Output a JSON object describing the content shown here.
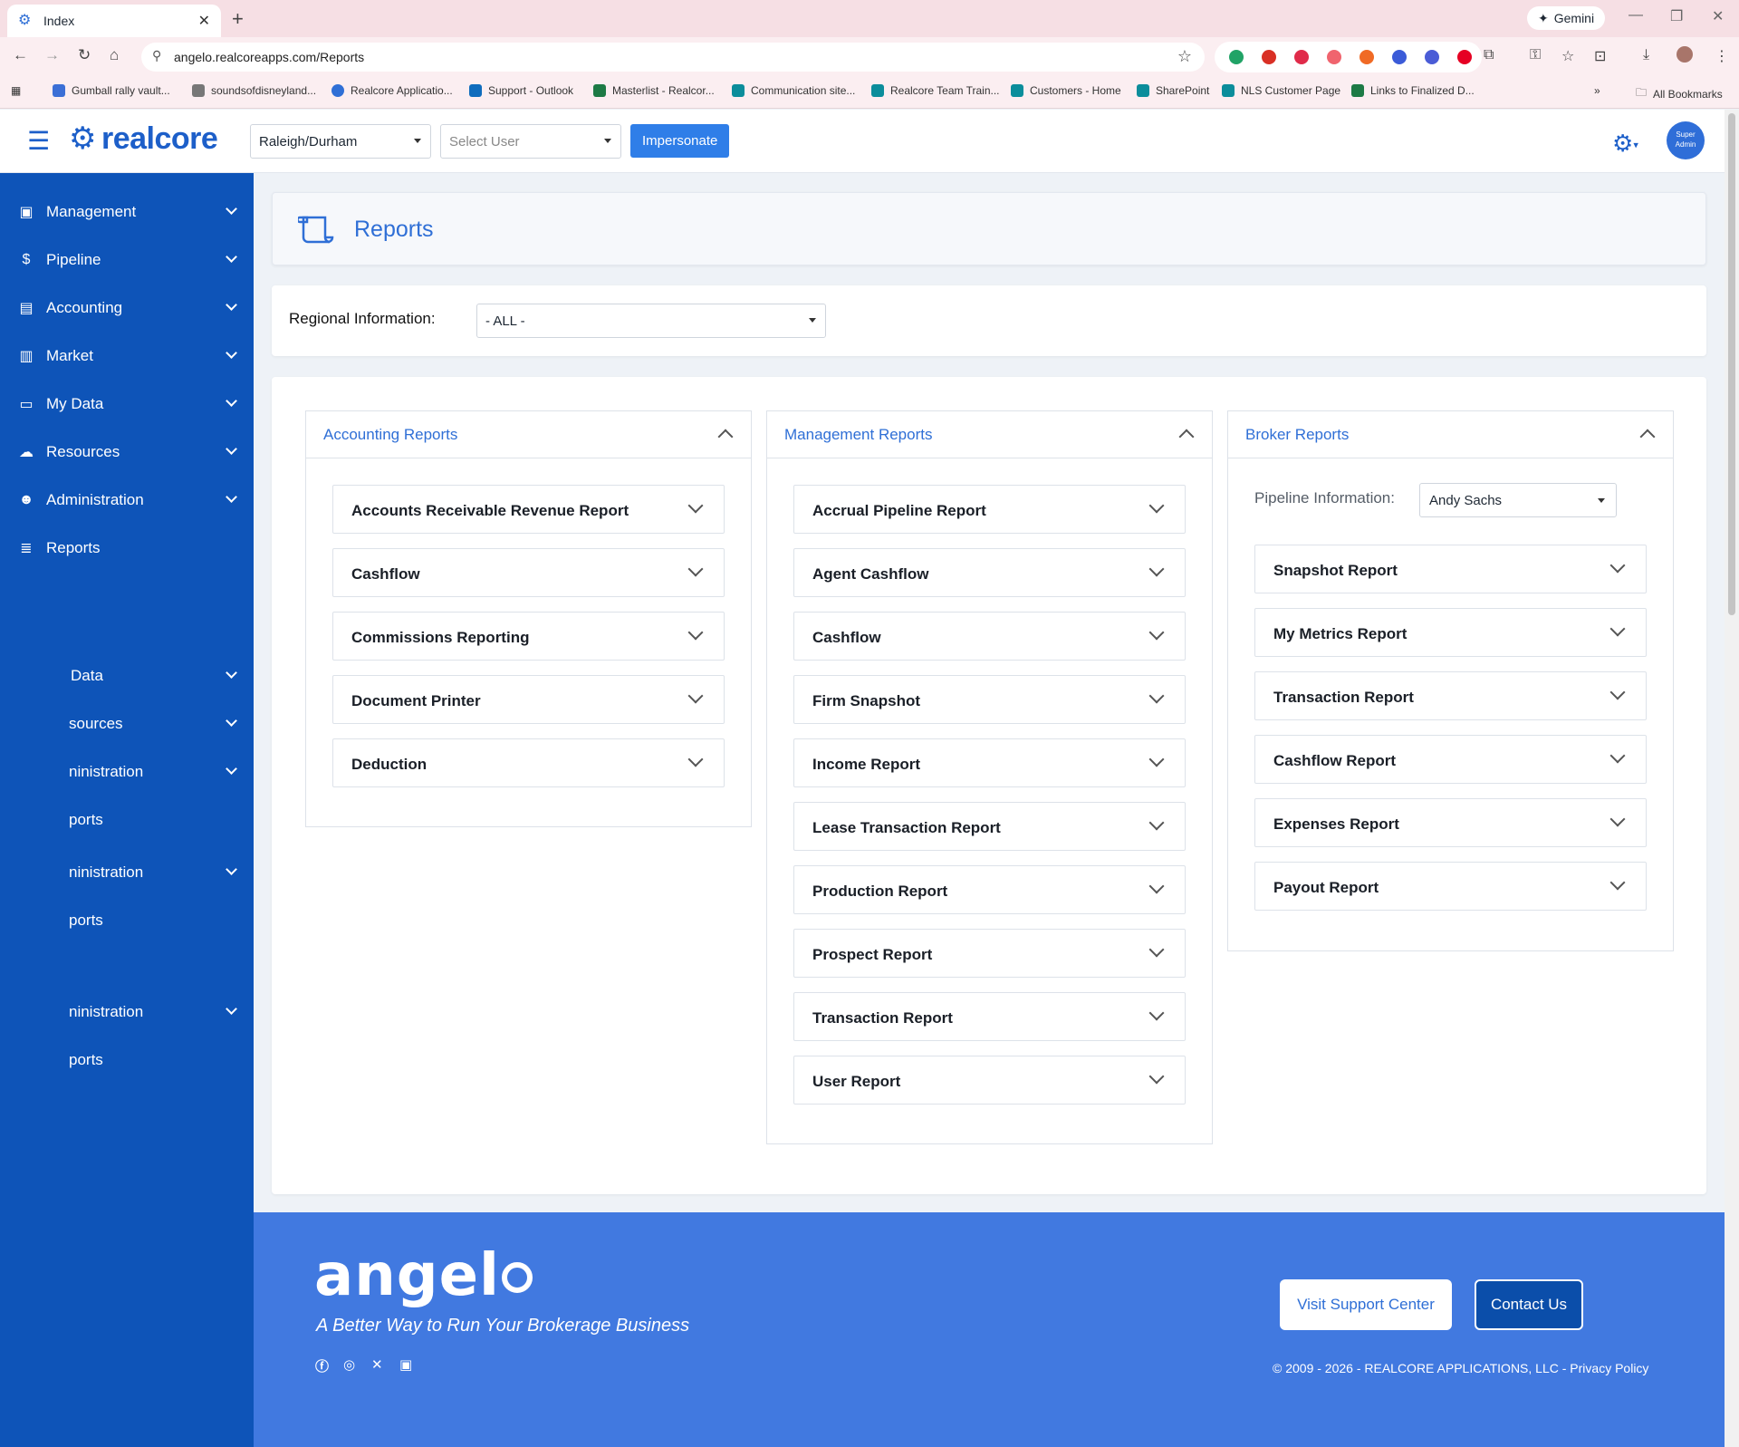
{
  "browser": {
    "tab_title": "Index",
    "gemini_label": "Gemini",
    "url": "angelo.realcoreapps.com/Reports",
    "bookmarks": [
      "Gumball rally vault...",
      "soundsofdisneyland...",
      "Realcore Applicatio...",
      "Support - Outlook",
      "Masterlist - Realcor...",
      "Communication site...",
      "Realcore Team Train...",
      "Customers - Home",
      "SharePoint",
      "NLS Customer Page",
      "Links to Finalized D..."
    ],
    "all_bookmarks": "All Bookmarks"
  },
  "header": {
    "logo_text": "realcore",
    "region_select": "Raleigh/Durham",
    "user_select_placeholder": "Select User",
    "impersonate_label": "Impersonate",
    "avatar_line1": "Super",
    "avatar_line2": "Admin"
  },
  "sidebar": {
    "items": [
      {
        "label": "Management",
        "icon": "dashboard-icon"
      },
      {
        "label": "Pipeline",
        "icon": "money-bag-icon"
      },
      {
        "label": "Accounting",
        "icon": "ledger-icon"
      },
      {
        "label": "Market",
        "icon": "building-icon"
      },
      {
        "label": "My Data",
        "icon": "devices-icon"
      },
      {
        "label": "Resources",
        "icon": "cloud-icon"
      },
      {
        "label": "Administration",
        "icon": "user-gear-icon"
      },
      {
        "label": "Reports",
        "icon": "scroll-icon"
      }
    ],
    "ghost_items": [
      "Data",
      "sources",
      "ninistration",
      "ports",
      "ninistration",
      "ports",
      "ninistration",
      "ports"
    ]
  },
  "page": {
    "title": "Reports",
    "regional_label": "Regional Information:",
    "regional_value": "- ALL -"
  },
  "panels": {
    "accounting": {
      "title": "Accounting Reports",
      "items": [
        "Accounts Receivable Revenue Report",
        "Cashflow",
        "Commissions Reporting",
        "Document Printer",
        "Deduction"
      ]
    },
    "management": {
      "title": "Management Reports",
      "items": [
        "Accrual Pipeline Report",
        "Agent Cashflow",
        "Cashflow",
        "Firm Snapshot",
        "Income Report",
        "Lease Transaction Report",
        "Production Report",
        "Prospect Report",
        "Transaction Report",
        "User Report"
      ]
    },
    "broker": {
      "title": "Broker Reports",
      "pipeline_label": "Pipeline Information:",
      "pipeline_value": "Andy Sachs",
      "items": [
        "Snapshot Report",
        "My Metrics Report",
        "Transaction Report",
        "Cashflow Report",
        "Expenses Report",
        "Payout Report"
      ]
    }
  },
  "footer": {
    "logo_text": "angel",
    "tagline": "A Better Way to Run Your Brokerage Business",
    "support_button": "Visit Support Center",
    "contact_button": "Contact Us",
    "copyright": "© 2009 - 2026 - REALCORE APPLICATIONS, LLC - Privacy Policy"
  },
  "colors": {
    "brand_blue": "#1d5fc9",
    "sidebar_blue": "#0e54b8",
    "footer_blue": "#4179e0",
    "link_blue": "#2f6fd6"
  }
}
